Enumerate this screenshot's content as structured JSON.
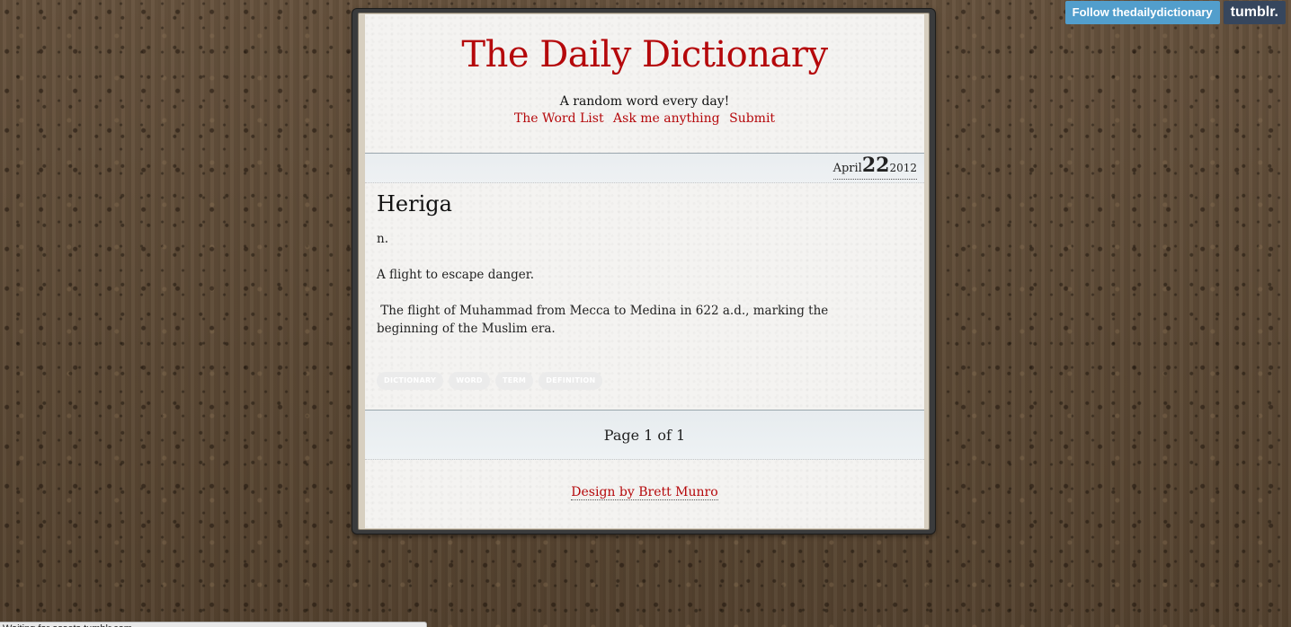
{
  "header": {
    "title": "The Daily Dictionary",
    "tagline": "A random word every day!",
    "nav": [
      "The Word List",
      "Ask me anything",
      "Submit"
    ]
  },
  "post": {
    "date": {
      "month": "April",
      "day": "22",
      "year": "2012"
    },
    "title": "Heriga",
    "part_of_speech": "n.",
    "definitions": [
      "A flight to escape danger.",
      " The flight of Muhammad from Mecca to Medina in 622 a.d., marking the beginning of the Muslim era."
    ],
    "tags": [
      "dictionary",
      "word",
      "term",
      "definition"
    ]
  },
  "pager": {
    "text": "Page 1 of 1"
  },
  "footer": {
    "credit": "Design by Brett Munro"
  },
  "tumblr": {
    "follow_label": "Follow thedailydictionary",
    "logo": "tumblr."
  },
  "status_bar": {
    "text": "Waiting for assets.tumblr.com..."
  },
  "colors": {
    "accent": "#b5080b",
    "follow_button": "#529ecc",
    "tumblr_logo": "#36465d"
  }
}
